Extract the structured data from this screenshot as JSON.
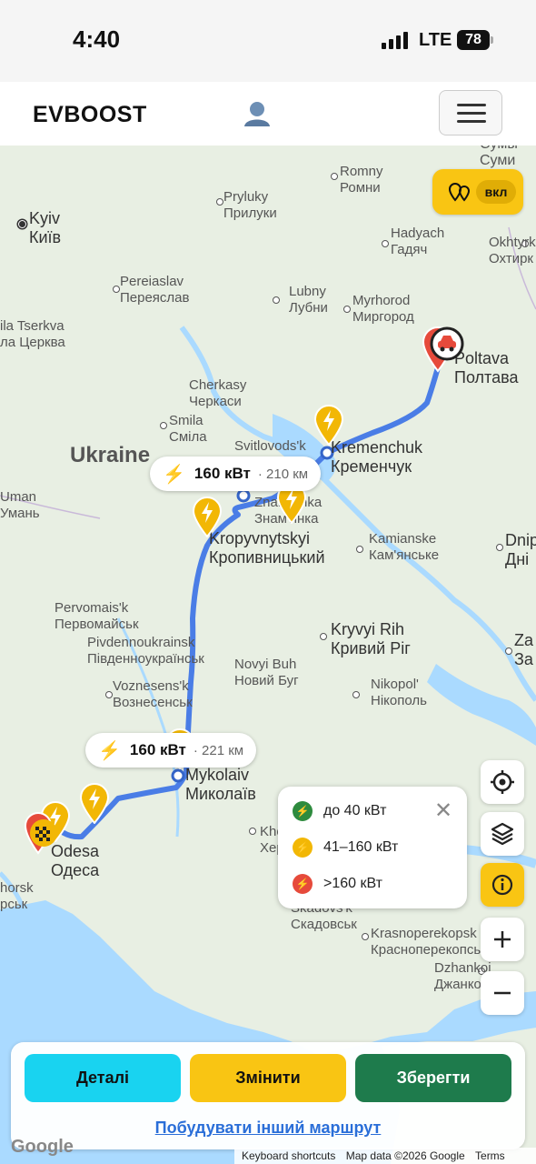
{
  "status_bar": {
    "time": "4:40",
    "network": "LTE",
    "battery": "78"
  },
  "header": {
    "logo": "EVBOOST",
    "user_icon": "user-icon",
    "menu_icon": "hamburger-menu-icon"
  },
  "map": {
    "cities": [
      {
        "name_en": "Kyiv",
        "name_uk": "Київ",
        "big": true,
        "capital": true
      },
      {
        "name_en": "Pryluky",
        "name_uk": "Прилуки"
      },
      {
        "name_en": "Romny",
        "name_uk": "Ромни"
      },
      {
        "name_en": "Сумы",
        "name_uk": "Суми"
      },
      {
        "name_en": "Hadyach",
        "name_uk": "Гадяч"
      },
      {
        "name_en": "Okhtyrk",
        "name_uk": "Охтирк"
      },
      {
        "name_en": "Pereiaslav",
        "name_uk": "Переяслав"
      },
      {
        "name_en": "Lubny",
        "name_uk": "Лубни"
      },
      {
        "name_en": "Myrhorod",
        "name_uk": "Миргород"
      },
      {
        "name_en": "ila Tserkva",
        "name_uk": "ла Церква"
      },
      {
        "name_en": "Poltava",
        "name_uk": "Полтава",
        "big": true
      },
      {
        "name_en": "Cherkasy",
        "name_uk": "Черкаси"
      },
      {
        "name_en": "Smila",
        "name_uk": "Сміла"
      },
      {
        "name_en": "Svitlovods'k",
        "name_uk": ""
      },
      {
        "name_en": "Kremenchuk",
        "name_uk": "Кременчук",
        "big": true
      },
      {
        "name_en": "Uman",
        "name_uk": "Умань"
      },
      {
        "name_en": "Znamianka",
        "name_uk": "Знам'янка"
      },
      {
        "name_en": "Kropyvnytskyi",
        "name_uk": "Кропивницький",
        "big": true
      },
      {
        "name_en": "Kamianske",
        "name_uk": "Кам'янське"
      },
      {
        "name_en": "Dnip",
        "name_uk": "Дні"
      },
      {
        "name_en": "Pervomais'k",
        "name_uk": "Первомайськ"
      },
      {
        "name_en": "Kryvyi Rih",
        "name_uk": "Кривий Ріг",
        "big": true
      },
      {
        "name_en": "Pivdennoukrainsk",
        "name_uk": "Південноукраїнськ"
      },
      {
        "name_en": "Za",
        "name_uk": "За"
      },
      {
        "name_en": "Novyi Buh",
        "name_uk": "Новий Буг"
      },
      {
        "name_en": "Voznesens'k",
        "name_uk": "Вознесенськ"
      },
      {
        "name_en": "Nikopol'",
        "name_uk": "Нікополь"
      },
      {
        "name_en": "Mykolaiv",
        "name_uk": "Миколаїв",
        "big": true
      },
      {
        "name_en": "Khers",
        "name_uk": "Херс"
      },
      {
        "name_en": "Odesa",
        "name_uk": "Одеса",
        "big": true
      },
      {
        "name_en": "horsk",
        "name_uk": "рськ"
      },
      {
        "name_en": "Skadovs'k",
        "name_uk": "Скадовськ"
      },
      {
        "name_en": "Krasnoperekopsk",
        "name_uk": "Красноперекопськ"
      },
      {
        "name_en": "Dzhankoi",
        "name_uk": "Джанкой"
      }
    ],
    "country_label": "Ukraine",
    "route_labels": [
      {
        "power": "160 кВт",
        "distance": "· 210 км"
      },
      {
        "power": "160 кВт",
        "distance": "· 221 км"
      }
    ],
    "toggle": {
      "label": "вкл",
      "icon": "route-pins-icon"
    },
    "legend": {
      "items": [
        {
          "label": "до 40 кВт",
          "color": "#2e8b3e"
        },
        {
          "label": "41–160 кВт",
          "color": "#f2b705"
        },
        {
          "label": ">160 кВт",
          "color": "#e64a3b"
        }
      ],
      "close_icon": "close-icon"
    },
    "side_buttons": [
      "locate-icon",
      "layers-icon",
      "info-icon",
      "zoom-in-icon",
      "zoom-out-icon"
    ],
    "colors": {
      "route": "#4a7de6",
      "water": "#aadaff",
      "land": "#e8efe3",
      "charger": "#f2b705",
      "start_pin": "#e64a3b"
    }
  },
  "panel": {
    "details_label": "Деталі",
    "edit_label": "Змінити",
    "save_label": "Зберегти",
    "other_route_label": "Побудувати інший маршрут"
  },
  "attribution": {
    "shortcuts": "Keyboard shortcuts",
    "data": "Map data ©2026 Google",
    "terms": "Terms",
    "google": "Google"
  }
}
